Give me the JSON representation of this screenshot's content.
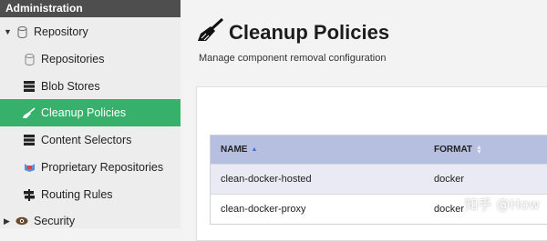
{
  "sidebar": {
    "header": "Administration",
    "items": [
      {
        "label": "Repository",
        "icon": "database-icon",
        "caret": "▼"
      },
      {
        "label": "Repositories",
        "icon": "database-icon"
      },
      {
        "label": "Blob Stores",
        "icon": "server-icon"
      },
      {
        "label": "Cleanup Policies",
        "icon": "broom-icon"
      },
      {
        "label": "Content Selectors",
        "icon": "layers-icon"
      },
      {
        "label": "Proprietary Repositories",
        "icon": "proprietary-icon"
      },
      {
        "label": "Routing Rules",
        "icon": "signpost-icon"
      },
      {
        "label": "Security",
        "icon": "eye-icon",
        "caret": "▶"
      }
    ]
  },
  "main": {
    "title": "Cleanup Policies",
    "subtitle": "Manage component removal configuration",
    "table": {
      "columns": [
        "NAME",
        "FORMAT"
      ],
      "rows": [
        {
          "name": "clean-docker-hosted",
          "format": "docker"
        },
        {
          "name": "clean-docker-proxy",
          "format": "docker"
        }
      ]
    }
  },
  "watermark": "知乎 @How",
  "colors": {
    "active": "#36b06a",
    "header_bg": "#4e4e4e",
    "table_header": "#b7bfe0"
  }
}
